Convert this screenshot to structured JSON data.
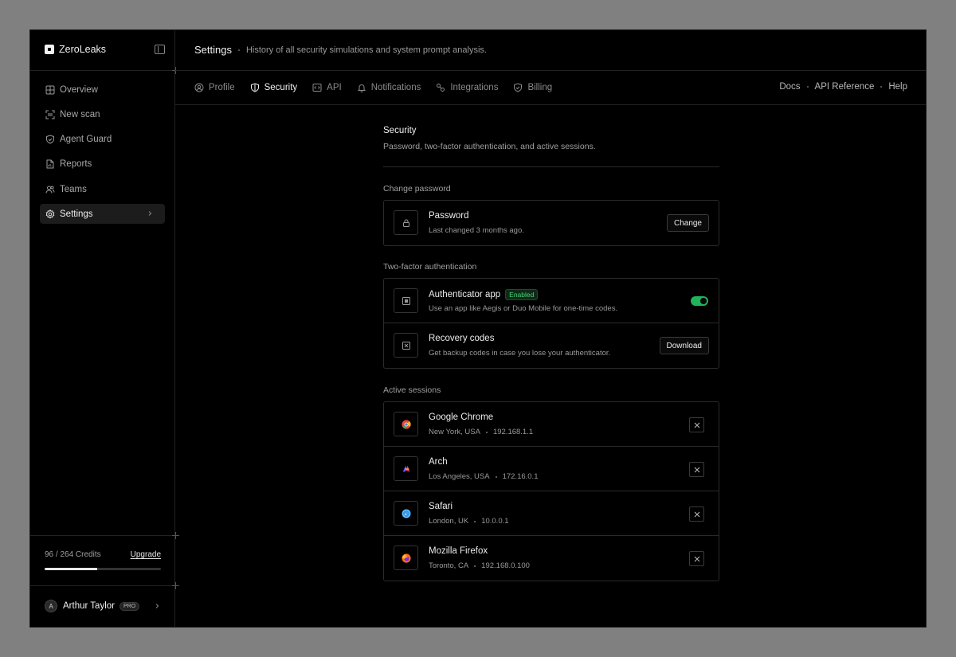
{
  "brand": {
    "name": "ZeroLeaks"
  },
  "sidebar": {
    "items": [
      {
        "label": "Overview",
        "icon": "grid-icon"
      },
      {
        "label": "New scan",
        "icon": "scan-icon"
      },
      {
        "label": "Agent Guard",
        "icon": "shield-icon"
      },
      {
        "label": "Reports",
        "icon": "file-icon"
      },
      {
        "label": "Teams",
        "icon": "users-icon"
      },
      {
        "label": "Settings",
        "icon": "gear-icon",
        "active": true
      }
    ],
    "credits": {
      "used": 96,
      "total": 264,
      "text": "96 / 264 Credits",
      "upgrade_label": "Upgrade",
      "fraction": 0.4545
    },
    "user": {
      "initial": "A",
      "name": "Arthur Taylor",
      "plan": "PRO"
    }
  },
  "header": {
    "title": "Settings",
    "subtitle": "History of all security simulations and system prompt analysis."
  },
  "tabs": [
    {
      "label": "Profile",
      "icon": "user-circle-icon"
    },
    {
      "label": "Security",
      "icon": "shield-icon",
      "active": true
    },
    {
      "label": "API",
      "icon": "code-icon"
    },
    {
      "label": "Notifications",
      "icon": "bell-icon"
    },
    {
      "label": "Integrations",
      "icon": "link-icon"
    },
    {
      "label": "Billing",
      "icon": "badge-icon"
    }
  ],
  "links": [
    "Docs",
    "API Reference",
    "Help"
  ],
  "security": {
    "title": "Security",
    "description": "Password, two-factor authentication, and active sessions.",
    "password_group": {
      "label": "Change password",
      "title": "Password",
      "subtitle": "Last changed 3 months ago.",
      "button": "Change"
    },
    "twofa_group": {
      "label": "Two-factor authentication",
      "authenticator": {
        "title": "Authenticator app",
        "badge": "Enabled",
        "subtitle": "Use an app like Aegis or Duo Mobile for one-time codes.",
        "enabled": true
      },
      "recovery": {
        "title": "Recovery codes",
        "subtitle": "Get backup codes in case you lose your authenticator.",
        "button": "Download"
      }
    },
    "sessions_group": {
      "label": "Active sessions",
      "sessions": [
        {
          "browser": "Google Chrome",
          "location": "New York, USA",
          "ip": "192.168.1.1",
          "icon": "chrome-icon",
          "color": "#e8453c"
        },
        {
          "browser": "Arch",
          "location": "Los Angeles, USA",
          "ip": "172.16.0.1",
          "icon": "arch-icon",
          "color": "#5b5bf5"
        },
        {
          "browser": "Safari",
          "location": "London, UK",
          "ip": "10.0.0.1",
          "icon": "safari-icon",
          "color": "#2d9cf0"
        },
        {
          "browser": "Mozilla Firefox",
          "location": "Toronto, CA",
          "ip": "192.168.0.100",
          "icon": "firefox-icon",
          "color": "#ff6a1a"
        }
      ]
    }
  }
}
